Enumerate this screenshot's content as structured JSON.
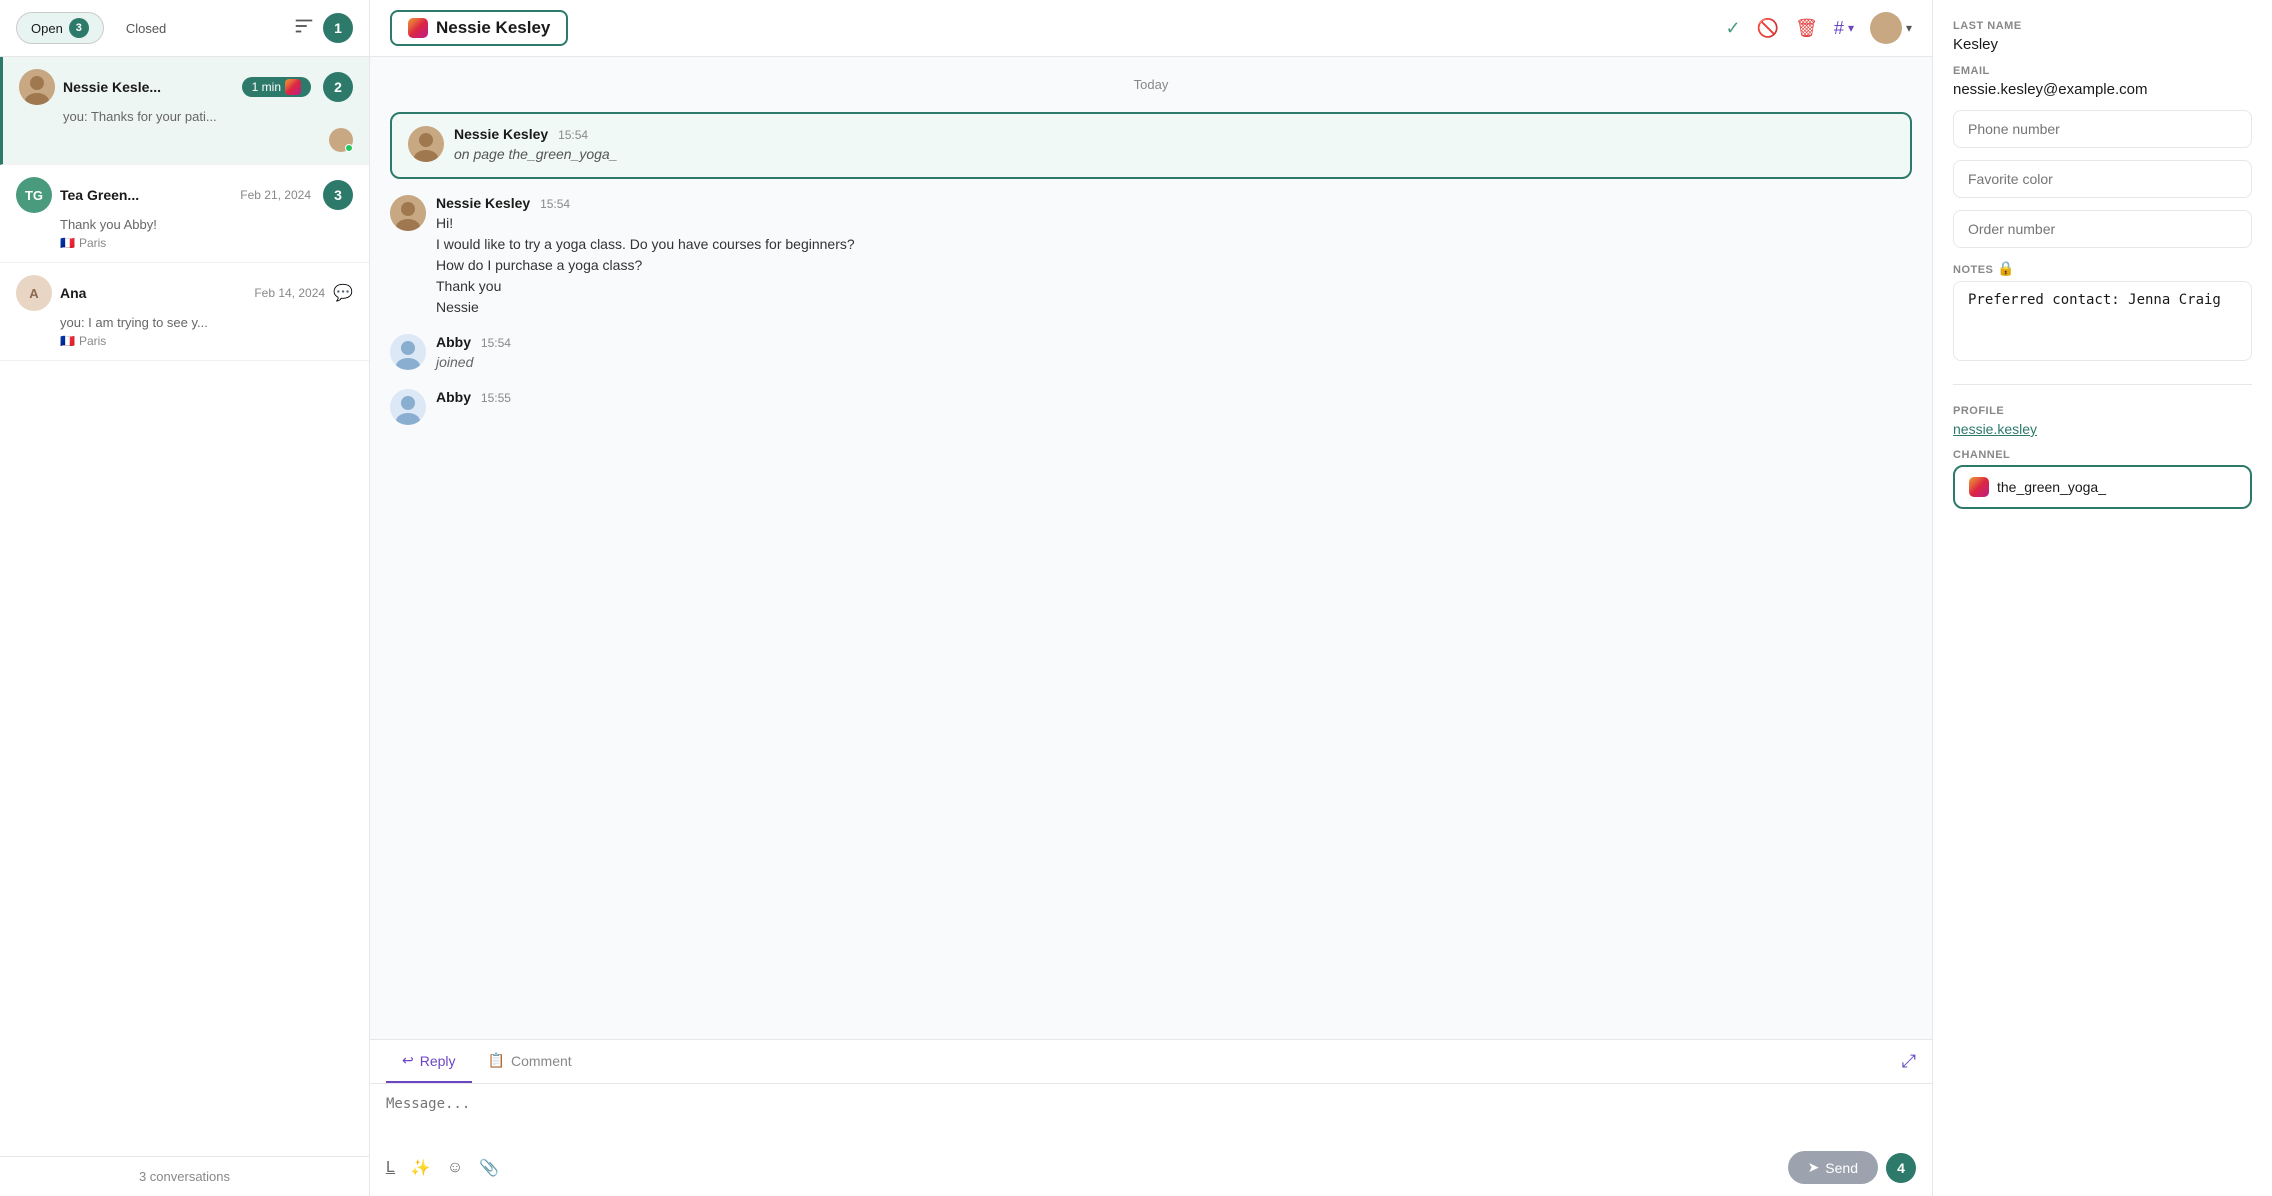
{
  "sidebar": {
    "tab_open": "Open",
    "tab_open_count": "3",
    "tab_closed": "Closed",
    "conversations_count": "3 conversations",
    "conversations": [
      {
        "id": "nessie",
        "name": "Nessie Kesle...",
        "time": "1 min",
        "preview": "you: Thanks for your pati...",
        "active": true,
        "has_instagram": true,
        "step": "2"
      },
      {
        "id": "tea",
        "name": "Tea Green...",
        "time": "Feb 21, 2024",
        "preview": "Thank you Abby!",
        "location": "Paris",
        "step": "3",
        "initials": "TG"
      },
      {
        "id": "ana",
        "name": "Ana",
        "time": "Feb 14, 2024",
        "preview": "you: I am trying to see y...",
        "location": "Paris",
        "has_comment": true,
        "initial": "A"
      }
    ]
  },
  "chat": {
    "contact_name": "Nessie Kesley",
    "date_divider": "Today",
    "messages": [
      {
        "id": "msg1",
        "sender": "Nessie Kesley",
        "time": "15:54",
        "sub": "on page the_green_yoga_",
        "highlighted": true
      },
      {
        "id": "msg2",
        "sender": "Nessie Kesley",
        "time": "15:54",
        "lines": [
          "Hi!",
          "I would like to try a yoga class. Do you have courses for beginners?",
          "How do I purchase a yoga class?",
          "Thank you",
          "Nessie"
        ]
      },
      {
        "id": "msg3",
        "sender": "Abby",
        "time": "15:54",
        "italic": "joined"
      },
      {
        "id": "msg4",
        "sender": "Abby",
        "time": "15:55",
        "partial": true
      }
    ],
    "reply_tab": "Reply",
    "comment_tab": "Comment",
    "message_placeholder": "Message...",
    "send_label": "Send"
  },
  "right_panel": {
    "last_name_label": "LAST NAME",
    "last_name_value": "Kesley",
    "email_label": "EMAIL",
    "email_value": "nessie.kesley@example.com",
    "phone_placeholder": "Phone number",
    "color_placeholder": "Favorite color",
    "order_placeholder": "Order number",
    "notes_label": "NOTES",
    "notes_value": "Preferred contact: Jenna Craig",
    "profile_label": "PROFILE",
    "profile_value": "nessie.kesley",
    "channel_label": "CHANNEL",
    "channel_value": "the_green_yoga_"
  },
  "step_badges": {
    "badge1": "1",
    "badge2": "2",
    "badge3": "3",
    "badge4": "4"
  }
}
